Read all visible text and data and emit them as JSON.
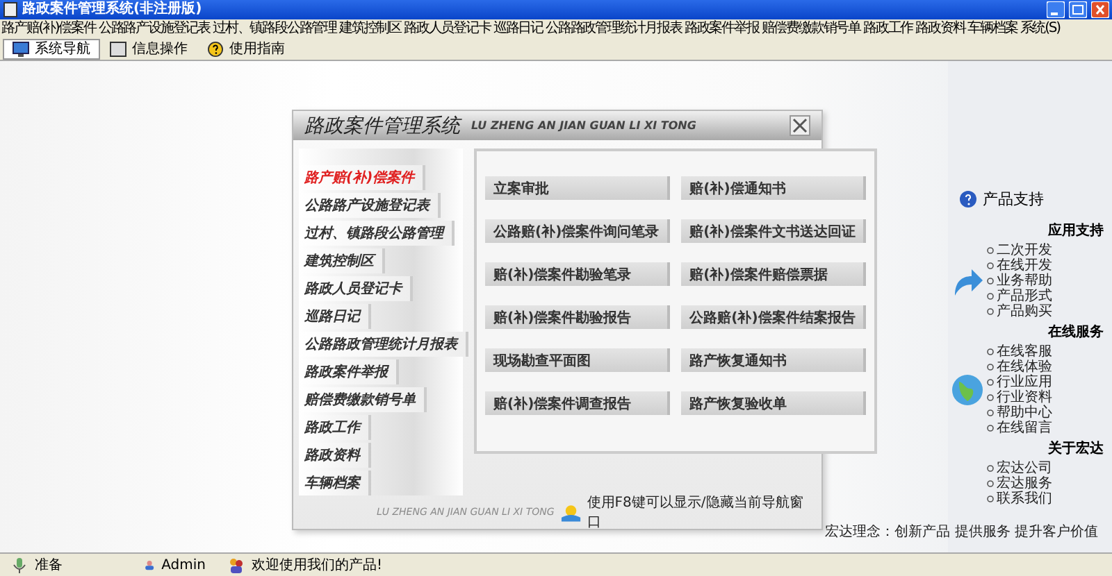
{
  "window": {
    "title": "路政案件管理系统(非注册版)"
  },
  "menu": [
    "路产赔(补)偿案件",
    "公路路产设施登记表",
    "过村、镇路段公路管理",
    "建筑控制区",
    "路政人员登记卡",
    "巡路日记",
    "公路路政管理统计月报表",
    "路政案件举报",
    "赔偿费缴款销号单",
    "路政工作",
    "路政资料",
    "车辆档案",
    "系统(S)"
  ],
  "toolbar": [
    {
      "label": "系统导航",
      "selected": true
    },
    {
      "label": "信息操作",
      "selected": false
    },
    {
      "label": "使用指南",
      "selected": false
    }
  ],
  "dialog": {
    "title": "路政案件管理系统",
    "subtitle": "LU ZHENG AN JIAN GUAN LI XI TONG",
    "nav": [
      {
        "label": "路产赔(补)偿案件",
        "selected": true
      },
      {
        "label": "公路路产设施登记表",
        "selected": false
      },
      {
        "label": "过村、镇路段公路管理",
        "selected": false
      },
      {
        "label": "建筑控制区",
        "selected": false
      },
      {
        "label": "路政人员登记卡",
        "selected": false
      },
      {
        "label": "巡路日记",
        "selected": false
      },
      {
        "label": "公路路政管理统计月报表",
        "selected": false
      },
      {
        "label": "路政案件举报",
        "selected": false
      },
      {
        "label": "赔偿费缴款销号单",
        "selected": false
      },
      {
        "label": "路政工作",
        "selected": false
      },
      {
        "label": "路政资料",
        "selected": false
      },
      {
        "label": "车辆档案",
        "selected": false
      }
    ],
    "buttons": [
      "立案审批",
      "赔(补)偿通知书",
      "公路赔(补)偿案件询问笔录",
      "赔(补)偿案件文书送达回证",
      "赔(补)偿案件勘验笔录",
      "赔(补)偿案件赔偿票据",
      "赔(补)偿案件勘验报告",
      "公路赔(补)偿案件结案报告",
      "现场勘查平面图",
      "路产恢复通知书",
      "赔(补)偿案件调查报告",
      "路产恢复验收单"
    ],
    "footer_text": "LU ZHENG AN JIAN GUAN LI XI TONG",
    "hint": "使用F8键可以显示/隐藏当前导航窗口"
  },
  "support": {
    "title": "产品支持",
    "sections": [
      {
        "heading": "应用支持",
        "items": [
          "二次开发",
          "在线开发",
          "业务帮助",
          "产品形式",
          "产品购买"
        ]
      },
      {
        "heading": "在线服务",
        "items": [
          "在线客服",
          "在线体验",
          "行业应用",
          "行业资料",
          "帮助中心",
          "在线留言"
        ]
      },
      {
        "heading": "关于宏达",
        "items": [
          "宏达公司",
          "宏达服务",
          "联系我们"
        ]
      }
    ]
  },
  "motto": "宏达理念：创新产品 提供服务 提升客户价值",
  "status_bar": [
    "准备",
    "Admin",
    "欢迎使用我们的产品!"
  ]
}
